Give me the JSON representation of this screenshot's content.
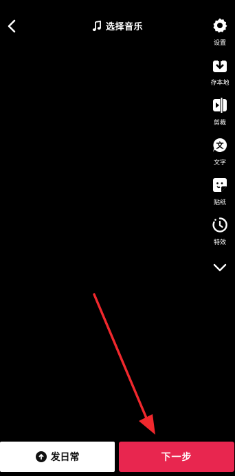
{
  "header": {
    "back_icon": "chevron-left-icon",
    "music_label": "选择音乐",
    "music_icon": "music-note-icon"
  },
  "toolbar": {
    "items": [
      {
        "label": "设置",
        "icon": "gear-icon"
      },
      {
        "label": "存本地",
        "icon": "download-icon"
      },
      {
        "label": "剪裁",
        "icon": "trim-icon"
      },
      {
        "label": "文字",
        "icon": "text-icon"
      },
      {
        "label": "贴纸",
        "icon": "sticker-icon"
      },
      {
        "label": "特效",
        "icon": "effects-icon"
      }
    ],
    "more_icon": "chevron-down-icon"
  },
  "footer": {
    "daily_label": "发日常",
    "next_label": "下一步"
  },
  "colors": {
    "background": "#000000",
    "next_button": "#e8264f",
    "annotation_arrow": "#f0282d"
  }
}
